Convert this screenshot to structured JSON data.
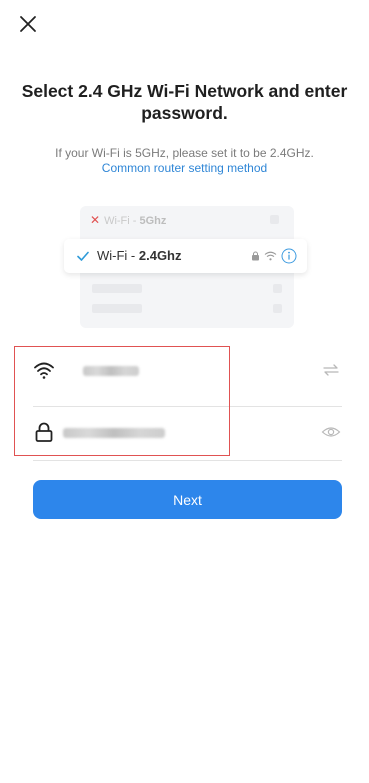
{
  "title": "Select 2.4 GHz Wi-Fi Network and enter password.",
  "subtitle": "If your Wi-Fi is 5GHz, please set it to be 2.4GHz.",
  "link": "Common router setting method",
  "illustration": {
    "row_5g_prefix": "Wi-Fi - ",
    "row_5g_band": "5Ghz",
    "row_24_prefix": "Wi-Fi - ",
    "row_24_band": "2.4Ghz"
  },
  "fields": {
    "wifi_icon": "wifi-icon",
    "password_icon": "lock-icon",
    "switch_icon": "switch-arrows-icon",
    "visibility_icon": "eye-icon"
  },
  "next_label": "Next",
  "colors": {
    "accent": "#2d86eb",
    "link": "#2f86d6",
    "highlight": "#e05252"
  }
}
